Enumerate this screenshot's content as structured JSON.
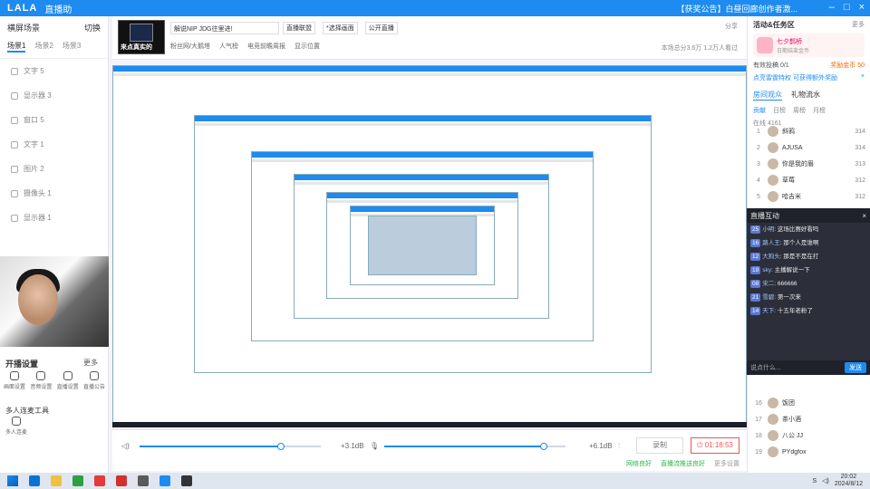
{
  "titlebar": {
    "logo": "LALA",
    "brand": "直播助",
    "notice": "【获奖公告】白昼回廊创作者激..."
  },
  "left": {
    "title": "横屏场景",
    "switch_label": "切换",
    "tabs": [
      "场景1",
      "场景2",
      "场景3"
    ],
    "sources": [
      "文字 5",
      "显示器 3",
      "窗口 5",
      "文字 1",
      "图片 2",
      "摄像头 1",
      "显示器 1"
    ],
    "tools_title": "开播设置",
    "tools_more": "更多",
    "tools": [
      "画面设置",
      "音频设置",
      "直播设置",
      "直播公告"
    ],
    "multi_title": "多人连麦工具",
    "multi_item": "多人连麦"
  },
  "room": {
    "cover_text": "来点真实的",
    "title_value": "解说NIP JDG往里进!",
    "buttons": [
      "直播联盟",
      "*选择画面",
      "公开直播"
    ],
    "meta": [
      "粉丝网/大鹅塔",
      "人气榜",
      "电竞前瞻周报",
      "显示位置"
    ],
    "share": "分享",
    "stats": "本场总分3.6万 1.2万人看过"
  },
  "controls": {
    "mic_db": "+3.1dB",
    "spk_db": "+6.1dB",
    "record": "录制",
    "live_timer": "01:18:53"
  },
  "status": {
    "net": "网络良好",
    "push": "直播流推送良好",
    "more": "更多设置"
  },
  "right": {
    "title": "活动&任务区",
    "more": "更多",
    "gift_title": "七夕鹊桥",
    "gift_sub": "日期结束金币",
    "task_label": "有效投稿 0/1",
    "task_value": "奖励金币 50",
    "notice": "点亮雷霆特权 可获得额外奖励",
    "tabs": [
      "房间观众",
      "礼物流水"
    ],
    "subtabs": [
      "贡献",
      "日榜",
      "周榜",
      "月榜"
    ],
    "count": "在线 4161",
    "rank": [
      {
        "n": "1",
        "name": "斜鸦",
        "score": "314"
      },
      {
        "n": "2",
        "name": "AJUSA",
        "score": "314"
      },
      {
        "n": "3",
        "name": "你是我的眉",
        "score": "313"
      },
      {
        "n": "4",
        "name": "草莓",
        "score": "312"
      },
      {
        "n": "5",
        "name": "哈吉米",
        "score": "312"
      }
    ],
    "rank2": [
      {
        "n": "16",
        "name": "饭团",
        "score": ""
      },
      {
        "n": "17",
        "name": "茶小酒",
        "score": ""
      },
      {
        "n": "18",
        "name": "八公 JJ",
        "score": ""
      },
      {
        "n": "19",
        "name": "PYdgfox",
        "score": ""
      }
    ]
  },
  "chat": {
    "title": "直播互动",
    "messages": [
      {
        "lv": "25",
        "user": "小明",
        "text": "这场比赛好看吗"
      },
      {
        "lv": "16",
        "user": "路人王",
        "text": "那个人是谁啊"
      },
      {
        "lv": "12",
        "user": "大狗头",
        "text": "那是不是在打"
      },
      {
        "lv": "19",
        "user": "sky",
        "text": "主播解说一下"
      },
      {
        "lv": "08",
        "user": "宋二",
        "text": "666666"
      },
      {
        "lv": "21",
        "user": "雪碧",
        "text": "第一次来"
      },
      {
        "lv": "14",
        "user": "天下",
        "text": "十五年老粉了"
      }
    ],
    "input_placeholder": "说点什么...",
    "send": "发送"
  },
  "taskbar": {
    "time": "20:02",
    "date": "2024/8/12"
  }
}
